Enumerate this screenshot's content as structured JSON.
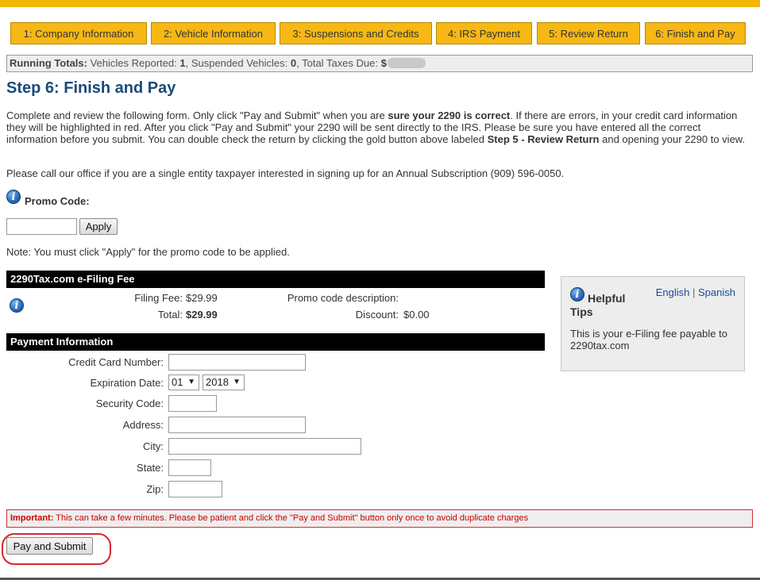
{
  "tabs": [
    {
      "label": "1: Company Information"
    },
    {
      "label": "2: Vehicle Information"
    },
    {
      "label": "3: Suspensions and Credits"
    },
    {
      "label": "4: IRS Payment"
    },
    {
      "label": "5: Review Return"
    },
    {
      "label": "6: Finish and Pay"
    }
  ],
  "running": {
    "label": "Running Totals:",
    "vehicles_label": "Vehicles Reported:",
    "vehicles": "1",
    "suspended_label": "Suspended Vehicles:",
    "suspended": "0",
    "taxes_label": "Total Taxes Due:",
    "taxes_prefix": "$"
  },
  "title": "Step 6: Finish and Pay",
  "intro": {
    "p1": "Complete and review the following form. Only click \"Pay and Submit\" when you are ",
    "bold1": "sure your 2290 is correct",
    "p2": ". If there are errors, in your credit card information they will be highlighted in red. After you click \"Pay and Submit\" your 2290 will be sent directly to the IRS. Please be sure you have entered all the correct information before you submit. You can double check the return by clicking the gold button above labeled ",
    "bold2": "Step 5 - Review Return",
    "p3": " and opening your 2290 to view."
  },
  "call_text": "Please call our office if you are a single entity taxpayer interested in signing up for an Annual Subscription (909) 596-0050.",
  "promo": {
    "label": "Promo Code:",
    "value": "",
    "apply_label": "Apply",
    "note": "Note: You must click \"Apply\" for the promo code to be applied."
  },
  "fee": {
    "header": "2290Tax.com e-Filing Fee",
    "filing_fee_label": "Filing Fee:",
    "filing_fee": "$29.99",
    "total_label": "Total:",
    "total": "$29.99",
    "promo_desc_label": "Promo code description:",
    "promo_desc": "",
    "discount_label": "Discount:",
    "discount": "$0.00"
  },
  "payment": {
    "header": "Payment Information",
    "card_label": "Credit Card Number:",
    "expiration_label": "Expiration Date:",
    "exp_month": "01",
    "exp_year": "2018",
    "security_label": "Security Code:",
    "address_label": "Address:",
    "city_label": "City:",
    "state_label": "State:",
    "zip_label": "Zip:"
  },
  "tips": {
    "title": "Helpful Tips",
    "english": "English",
    "separator": "|",
    "spanish": "Spanish",
    "text": "This is your e-Filing fee payable to 2290tax.com"
  },
  "important": {
    "label": "Important:",
    "text": " This can take a few minutes. Please be patient and click the \"Pay and Submit\" button only once to avoid duplicate charges"
  },
  "submit_label": "Pay and Submit",
  "colors": {
    "tab_bg": "#f7b815",
    "title_blue": "#1a4a7a",
    "important_red": "#cc0000",
    "highlight_circle": "#d8262e"
  }
}
